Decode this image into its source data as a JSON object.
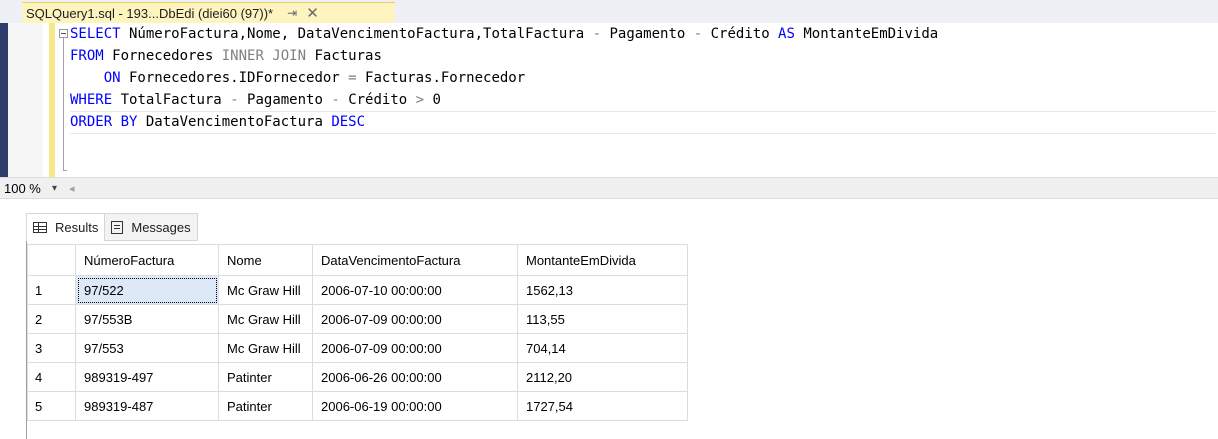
{
  "document_tab": {
    "title": "SQLQuery1.sql - 193...DbEdi (diei60 (97))*",
    "pin_glyph": "⇥",
    "close_glyph": "✕"
  },
  "editor": {
    "lines": [
      [
        {
          "t": "SELECT",
          "c": "kw"
        },
        {
          "t": " NúmeroFactura,Nome, DataVencimentoFactura,TotalFactura ",
          "c": ""
        },
        {
          "t": "-",
          "c": "op"
        },
        {
          "t": " Pagamento ",
          "c": ""
        },
        {
          "t": "-",
          "c": "op"
        },
        {
          "t": " Crédito ",
          "c": ""
        },
        {
          "t": "AS",
          "c": "kw"
        },
        {
          "t": " MontanteEmDivida",
          "c": ""
        }
      ],
      [
        {
          "t": "FROM",
          "c": "kw"
        },
        {
          "t": " Fornecedores ",
          "c": ""
        },
        {
          "t": "INNER JOIN",
          "c": "kw-gray"
        },
        {
          "t": " Facturas",
          "c": ""
        }
      ],
      [
        {
          "t": "    ON",
          "c": "kw"
        },
        {
          "t": " Fornecedores.IDFornecedor ",
          "c": ""
        },
        {
          "t": "=",
          "c": "op"
        },
        {
          "t": " Facturas.Fornecedor",
          "c": ""
        }
      ],
      [
        {
          "t": "WHERE",
          "c": "kw"
        },
        {
          "t": " TotalFactura ",
          "c": ""
        },
        {
          "t": "-",
          "c": "op"
        },
        {
          "t": " Pagamento ",
          "c": ""
        },
        {
          "t": "-",
          "c": "op"
        },
        {
          "t": " Crédito ",
          "c": ""
        },
        {
          "t": ">",
          "c": "op"
        },
        {
          "t": " 0",
          "c": ""
        }
      ],
      [
        {
          "t": "ORDER BY",
          "c": "kw"
        },
        {
          "t": " DataVencimentoFactura ",
          "c": ""
        },
        {
          "t": "DESC",
          "c": "kw"
        }
      ]
    ]
  },
  "zoom": {
    "value": "100 %",
    "dropdown_glyph": "▾",
    "scroll_left_glyph": "◂"
  },
  "results": {
    "tabs": [
      {
        "label": "Results",
        "icon": "grid-icon",
        "active": true
      },
      {
        "label": "Messages",
        "icon": "messages-icon",
        "active": false
      }
    ],
    "columns": [
      "NúmeroFactura",
      "Nome",
      "DataVencimentoFactura",
      "MontanteEmDivida"
    ],
    "rows": [
      {
        "n": "1",
        "cells": [
          "97/522",
          "Mc Graw Hill",
          "2006-07-10 00:00:00",
          "1562,13"
        ]
      },
      {
        "n": "2",
        "cells": [
          "97/553B",
          "Mc Graw Hill",
          "2006-07-09 00:00:00",
          "113,55"
        ]
      },
      {
        "n": "3",
        "cells": [
          "97/553",
          "Mc Graw Hill",
          "2006-07-09 00:00:00",
          "704,14"
        ]
      },
      {
        "n": "4",
        "cells": [
          "989319-497",
          "Patinter",
          "2006-06-26 00:00:00",
          "2112,20"
        ]
      },
      {
        "n": "5",
        "cells": [
          "989319-487",
          "Patinter",
          "2006-06-19 00:00:00",
          "1727,54"
        ]
      }
    ]
  }
}
